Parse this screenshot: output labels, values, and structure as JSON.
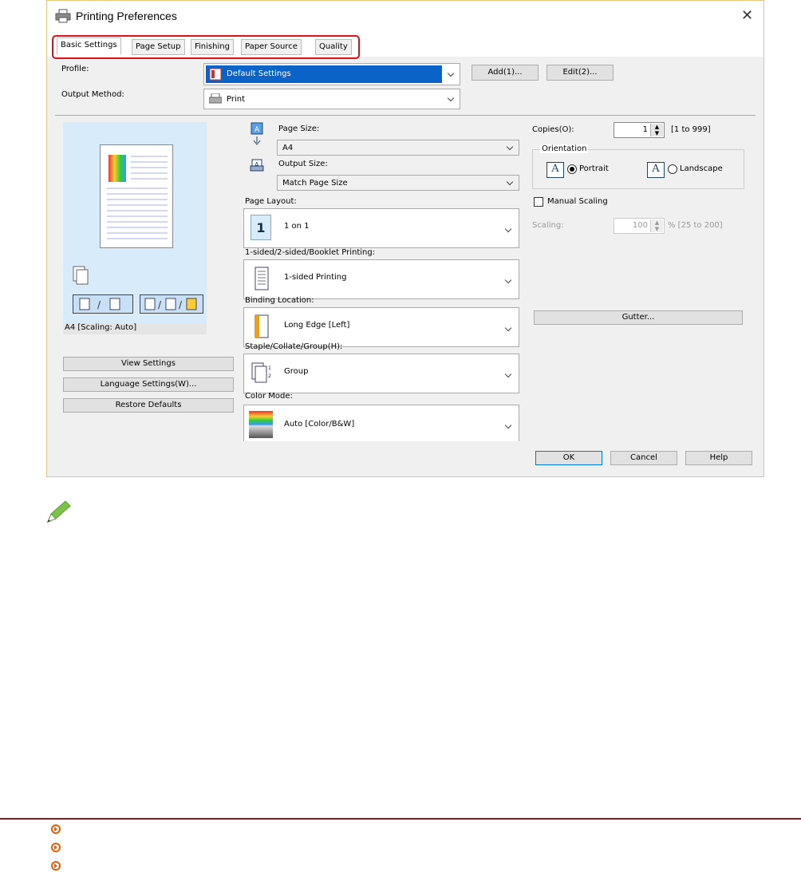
{
  "window": {
    "title": "Printing Preferences",
    "close": "✕"
  },
  "tabs": [
    "Basic Settings",
    "Page Setup",
    "Finishing",
    "Paper Source",
    "Quality"
  ],
  "profile": {
    "label": "Profile:",
    "value": "Default Settings",
    "add": "Add(1)...",
    "edit": "Edit(2)..."
  },
  "output_method": {
    "label": "Output Method:",
    "value": "Print"
  },
  "preview": {
    "caption": "A4 [Scaling: Auto]"
  },
  "left_buttons": {
    "view": "View Settings",
    "language": "Language Settings(W)...",
    "restore": "Restore Defaults"
  },
  "page_size": {
    "label": "Page Size:",
    "value": "A4"
  },
  "output_size": {
    "label": "Output Size:",
    "value": "Match Page Size"
  },
  "page_layout": {
    "label": "Page Layout:",
    "value": "1 on 1",
    "icon_text": "1"
  },
  "sided": {
    "label": "1-sided/2-sided/Booklet Printing:",
    "value": "1-sided Printing"
  },
  "binding": {
    "label": "Binding Location:",
    "value": "Long Edge [Left]"
  },
  "staple": {
    "label": "Staple/Collate/Group(H):",
    "value": "Group"
  },
  "color_mode": {
    "label": "Color Mode:",
    "value": "Auto [Color/B&W]"
  },
  "copies": {
    "label": "Copies(O):",
    "value": "1",
    "range": "[1 to 999]"
  },
  "orientation": {
    "label": "Orientation",
    "portrait": "Portrait",
    "landscape": "Landscape",
    "icon_letter": "A"
  },
  "manual_scaling": {
    "label": "Manual Scaling"
  },
  "scaling": {
    "label": "Scaling:",
    "value": "100",
    "range": "% [25 to 200]"
  },
  "gutter": {
    "label": "Gutter..."
  },
  "footer_buttons": {
    "ok": "OK",
    "cancel": "Cancel",
    "help": "Help"
  },
  "colors": {
    "selection": "#0a64c8",
    "highlight": "#e0101c",
    "accent_line": "#8b1a1a",
    "link_icon": "#e06010",
    "preview_bg": "#d7ebfa"
  }
}
